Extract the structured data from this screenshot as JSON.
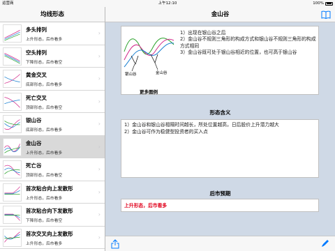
{
  "status": {
    "carrier": "运营商",
    "time": "上午12:10",
    "battery": "100%"
  },
  "left": {
    "title": "均线形态",
    "items": [
      {
        "title": "多头排列",
        "sub": "上升形态，后市看多",
        "selected": false
      },
      {
        "title": "空头排列",
        "sub": "下降形态，后市看空",
        "selected": false
      },
      {
        "title": "黄金交叉",
        "sub": "底部形态，后市看多",
        "selected": false
      },
      {
        "title": "死亡交叉",
        "sub": "顶部形态，后市看空",
        "selected": false
      },
      {
        "title": "银山谷",
        "sub": "底部形态，后市看多",
        "selected": false
      },
      {
        "title": "金山谷",
        "sub": "上升形态，后市看多",
        "selected": true
      },
      {
        "title": "死亡谷",
        "sub": "顶部形态，后市看空",
        "selected": false
      },
      {
        "title": "首次粘合向上发散形",
        "sub": "上升形态，后市看多",
        "selected": false
      },
      {
        "title": "首次粘合向下发散形",
        "sub": "下降形态，后市看空",
        "selected": false
      },
      {
        "title": "首次交叉向上发散形",
        "sub": "上升形态，后市看多",
        "selected": false
      }
    ]
  },
  "right": {
    "title": "金山谷",
    "diagram": {
      "label_left": "银山谷",
      "label_right": "金山谷"
    },
    "more_label": "更多图例",
    "desc_lines": [
      "1）出现在银山谷之后",
      "2）金山谷不规则三角形的构成方式和银山谷不规则三角形的构成方式相同",
      "3）金山谷既可处于银山谷相近的位置，也可高于银山谷"
    ],
    "meaning_title": "形态含义",
    "meaning_lines": [
      "1）金山谷和银山谷相隔时间越长，所处位置越高，日后股价上升潜力越大",
      "2）金山谷可作为稳健型投资者的买入点"
    ],
    "outlook_title": "后市预期",
    "outlook_text": "上升形态，后市看多"
  },
  "colors": {
    "accent": "#007aff",
    "outlook": "#e0001b",
    "panel": "#cfd9e6"
  },
  "icons": {
    "book": "book-icon",
    "share": "share-icon",
    "edit": "pencil-icon",
    "chevron": "chevron-right-icon"
  }
}
